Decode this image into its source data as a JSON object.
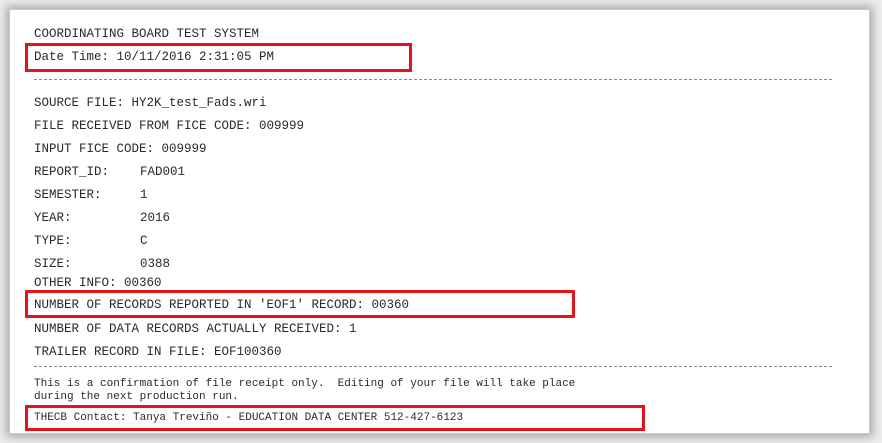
{
  "report": {
    "title": "COORDINATING BOARD TEST SYSTEM",
    "date_time": "Date Time: 10/11/2016 2:31:05 PM",
    "source_file": "SOURCE FILE: HY2K_test_Fads.wri",
    "received_from": "FILE RECEIVED FROM FICE CODE: 009999",
    "input_fice": "INPUT FICE CODE: 009999",
    "fields": [
      {
        "label": "REPORT_ID:",
        "value": "FAD001"
      },
      {
        "label": "SEMESTER:",
        "value": "1"
      },
      {
        "label": "YEAR:",
        "value": "2016"
      },
      {
        "label": "TYPE:",
        "value": "C"
      },
      {
        "label": "SIZE:",
        "value": "0388"
      }
    ],
    "other_info": "OTHER INFO: 00360",
    "records_reported": "NUMBER OF RECORDS REPORTED IN 'EOF1' RECORD: 00360",
    "records_received": "NUMBER OF DATA RECORDS ACTUALLY RECEIVED: 1",
    "trailer_record": "TRAILER RECORD IN FILE: EOF100360",
    "confirmation_line1": "This is a confirmation of file receipt only.  Editing of your file will take place",
    "confirmation_line2": "during the next production run.",
    "contact": "THECB Contact: Tanya Treviño - EDUCATION DATA CENTER 512-427-6123"
  },
  "colors": {
    "highlight": "#e3141b",
    "text": "#2a2a2a",
    "paper": "#ffffff"
  }
}
